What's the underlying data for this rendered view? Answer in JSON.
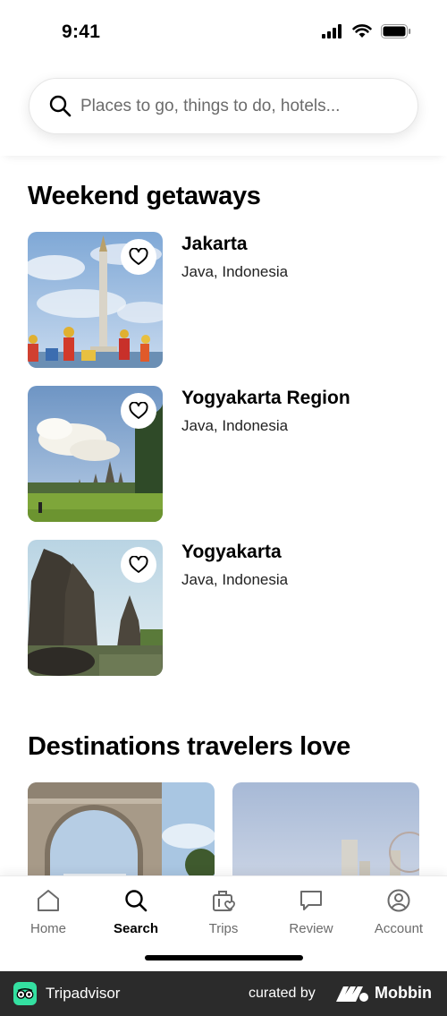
{
  "status_bar": {
    "time": "9:41",
    "icons": [
      "signal-icon",
      "wifi-icon",
      "battery-icon"
    ]
  },
  "search": {
    "placeholder": "Places to go, things to do, hotels...",
    "icon": "search-icon"
  },
  "weekend": {
    "title": "Weekend getaways",
    "items": [
      {
        "title": "Jakarta",
        "subtitle": "Java, Indonesia"
      },
      {
        "title": "Yogyakarta Region",
        "subtitle": "Java, Indonesia"
      },
      {
        "title": "Yogyakarta",
        "subtitle": "Java, Indonesia"
      }
    ]
  },
  "destinations": {
    "title": "Destinations travelers love"
  },
  "tabs": [
    {
      "label": "Home",
      "icon": "home-icon"
    },
    {
      "label": "Search",
      "icon": "search-icon",
      "active": true
    },
    {
      "label": "Trips",
      "icon": "trips-icon"
    },
    {
      "label": "Review",
      "icon": "review-icon"
    },
    {
      "label": "Account",
      "icon": "account-icon"
    }
  ],
  "footer": {
    "brand": "Tripadvisor",
    "curated_by": "curated by",
    "curator": "Mobbin"
  },
  "colors": {
    "brand_green": "#34e0a1",
    "footer_bg": "#2b2b2b",
    "muted_text": "#6b6b6b"
  }
}
